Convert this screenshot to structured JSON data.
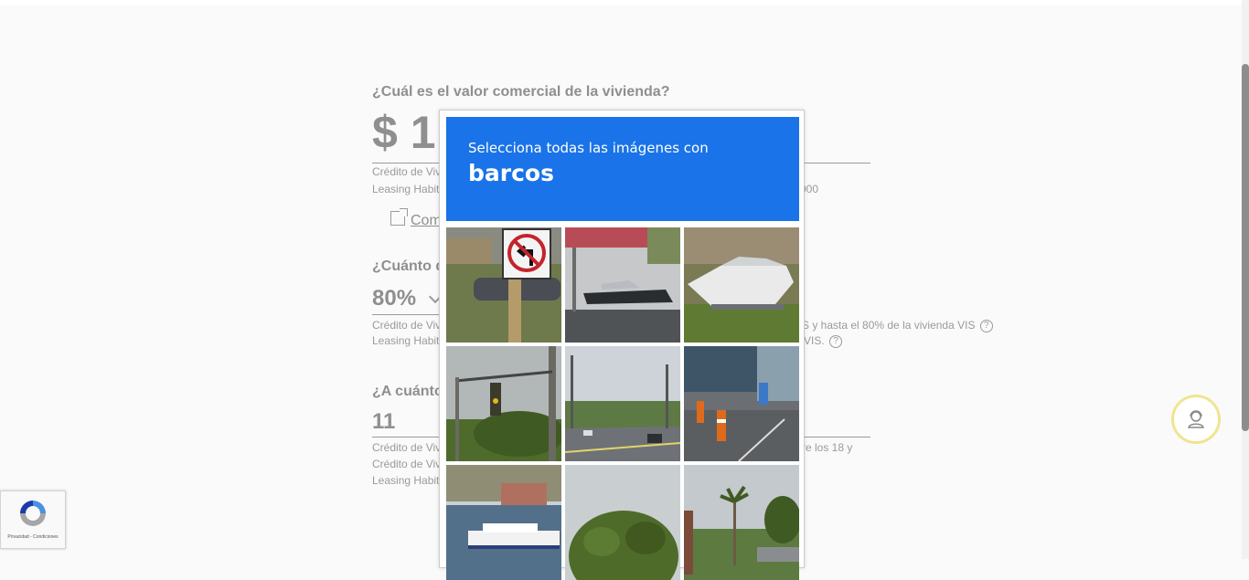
{
  "form": {
    "q1": {
      "label": "¿Cuál es el valor comercial de la vivienda?",
      "value": "$ 1",
      "note1": "Crédito de Viv",
      "note2": "Leasing Habit",
      "note2_tail": "000"
    },
    "calc_link": "Com",
    "q2": {
      "label": "¿Cuánto d",
      "value": "80%",
      "note1": "Crédito de Viv",
      "note1_tail": "S y hasta el 80% de la vivienda VIS",
      "note2": "Leasing Habit",
      "note2_tail": "VIS.",
      "help": "?"
    },
    "q3": {
      "label": "¿A cuánto",
      "value": "11",
      "note1": "Crédito de Viv",
      "note1_tail": "re los 18 y",
      "note2": "Crédito de Viv",
      "note3": "Leasing Habit"
    }
  },
  "captcha": {
    "instruction": "Selecciona todas las imágenes con",
    "target": "barcos",
    "header_color": "#1a73e8",
    "tiles": [
      {
        "label": "no-left-turn-sign"
      },
      {
        "label": "boat-on-trailer"
      },
      {
        "label": "boat-on-grass"
      },
      {
        "label": "traffic-light"
      },
      {
        "label": "road"
      },
      {
        "label": "street-construction"
      },
      {
        "label": "ferry-harbor"
      },
      {
        "label": "tree"
      },
      {
        "label": "palm-street"
      }
    ]
  },
  "recaptcha": {
    "links": "Privacidad - Condiciones"
  },
  "support": {
    "icon": "support-agent-icon"
  }
}
